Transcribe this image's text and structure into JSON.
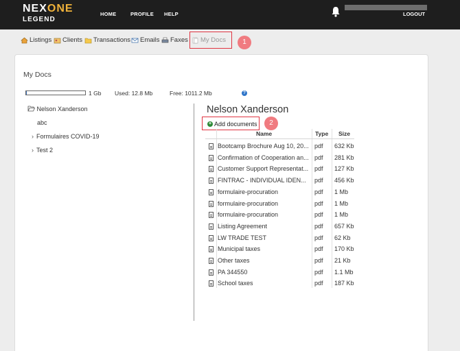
{
  "header": {
    "logo_main_a": "NEX",
    "logo_main_b": "ONE",
    "logo_sub": "LEGEND",
    "nav": [
      "HOME",
      "PROFILE",
      "HELP"
    ],
    "logout": "LOGOUT"
  },
  "subnav": {
    "items": [
      "Listings",
      "Clients",
      "Transactions",
      "Emails",
      "Faxes",
      "My Docs"
    ]
  },
  "markers": [
    "1",
    "2"
  ],
  "panel": {
    "title": "My Docs",
    "storage": {
      "capacity": "1 Gb",
      "used": "Used: 12.8 Mb",
      "free": "Free: 1011.2 Mb",
      "used_fraction": 0.0125
    },
    "help": "?"
  },
  "tree": {
    "root": "Nelson Xanderson",
    "children": [
      "abc",
      "Formulaires COVID-19",
      "Test 2"
    ]
  },
  "docs": {
    "folder_title": "Nelson Xanderson",
    "add_label": "Add documents",
    "columns": [
      "Name",
      "Type",
      "Size"
    ],
    "rows": [
      {
        "name": "Bootcamp Brochure Aug 10, 20...",
        "type": "pdf",
        "size": "632 Kb"
      },
      {
        "name": "Confirmation of Cooperation an...",
        "type": "pdf",
        "size": "281 Kb"
      },
      {
        "name": "Customer Support Representat...",
        "type": "pdf",
        "size": "127 Kb"
      },
      {
        "name": "FINTRAC - INDIVIDUAL IDEN...",
        "type": "pdf",
        "size": "456 Kb"
      },
      {
        "name": "formulaire-procuration",
        "type": "pdf",
        "size": "1 Mb"
      },
      {
        "name": "formulaire-procuration",
        "type": "pdf",
        "size": "1 Mb"
      },
      {
        "name": "formulaire-procuration",
        "type": "pdf",
        "size": "1 Mb"
      },
      {
        "name": "Listing Agreement",
        "type": "pdf",
        "size": "657 Kb"
      },
      {
        "name": "LW TRADE TEST",
        "type": "pdf",
        "size": "62 Kb"
      },
      {
        "name": "Municipal taxes",
        "type": "pdf",
        "size": "170 Kb"
      },
      {
        "name": "Other taxes",
        "type": "pdf",
        "size": "21 Kb"
      },
      {
        "name": "PA 344550",
        "type": "pdf",
        "size": "1.1 Mb"
      },
      {
        "name": "School taxes",
        "type": "pdf",
        "size": "187 Kb"
      }
    ]
  },
  "colors": {
    "accent": "#e03340",
    "marker": "#f07b80",
    "topbar": "#1e1e1e",
    "logo_accent": "#f0b23a",
    "add_icon": "#2d8a36"
  },
  "icons": [
    "bell-icon",
    "house-icon",
    "clients-icon",
    "folder-icon",
    "email-icon",
    "printer-icon",
    "docs-icon",
    "help-icon",
    "open-folder-icon",
    "plus-circle-icon",
    "document-icon"
  ]
}
